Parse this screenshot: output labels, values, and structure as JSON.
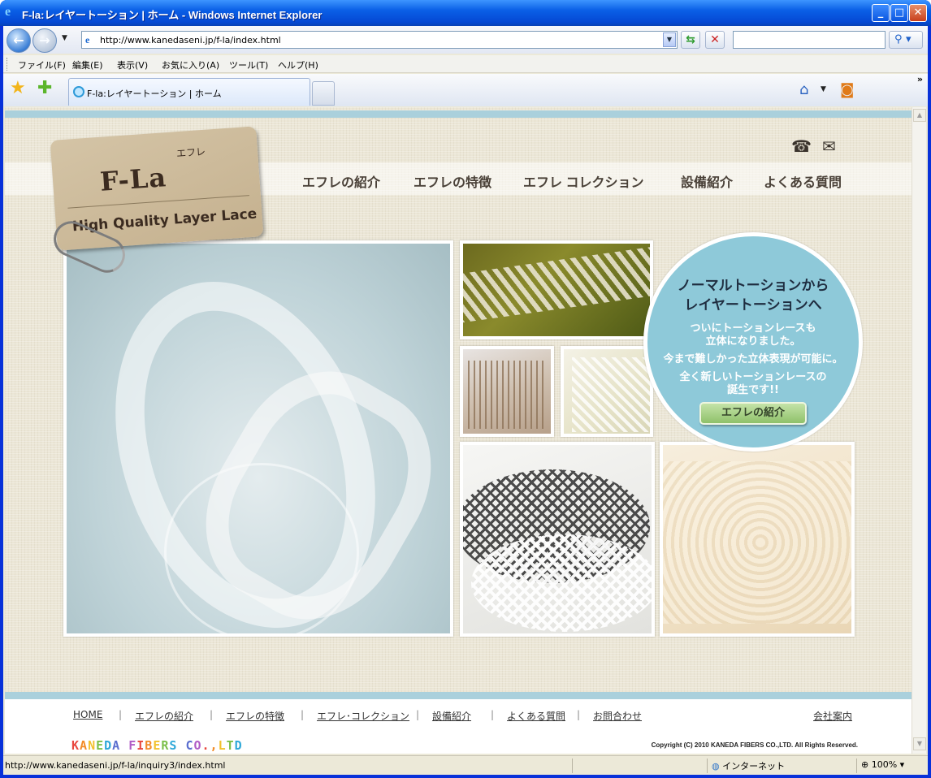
{
  "window": {
    "title": "F-la:レイヤートーション | ホーム - Windows Internet Explorer",
    "controls": {
      "minimize": "_",
      "maximize": "□",
      "close": "✕"
    }
  },
  "address_bar": {
    "url": "http://www.kanedaseni.jp/f-la/index.html",
    "search_placeholder": ""
  },
  "menu": [
    "ファイル(F)",
    "編集(E)",
    "表示(V)",
    "お気に入り(A)",
    "ツール(T)",
    "ヘルプ(H)"
  ],
  "tabs": [
    {
      "label": "F-la:レイヤートーション | ホーム",
      "active": true
    }
  ],
  "site": {
    "logo": {
      "mark": "F-La",
      "kana": "エフレ",
      "tagline": "High Quality Layer Lace"
    },
    "nav": [
      "エフレの紹介",
      "エフレの特徴",
      "エフレ コレクション",
      "設備紹介",
      "よくある質問"
    ],
    "promo": {
      "heading": [
        "ノーマルトーションから",
        "レイヤートーションへ"
      ],
      "body": [
        "ついにトーションレースも",
        "立体になりました。",
        "今まで難しかった立体表現が可能に。",
        "全く新しいトーションレースの",
        "誕生です!!"
      ],
      "button": "エフレの紹介"
    },
    "footer_nav": [
      "HOME",
      "エフレの紹介",
      "エフレの特徴",
      "エフレ･コレクション",
      "設備紹介",
      "よくある質問",
      "お問合わせ"
    ],
    "footer_separator": "|",
    "company_link": "会社案内",
    "company_name": "KANEDA FIBERS CO.,LTD",
    "company_colors": [
      "#e8473f",
      "#f28c28",
      "#f2c12e",
      "#7bbf4a",
      "#2fa8d8",
      "#5b6fcf",
      "#b05cc6"
    ],
    "copyright": "Copyright (C) 2010 KANEDA FIBERS CO.,LTD. All Rights Reserved."
  },
  "status_bar": {
    "text": "http://www.kanedaseni.jp/f-la/inquiry3/index.html",
    "zone": "インターネット",
    "zoom": "100%"
  },
  "colors": {
    "accent_band": "#aad0dc",
    "promo_circle": "#8ec9d9",
    "title_bar": "#0a5fe6"
  }
}
